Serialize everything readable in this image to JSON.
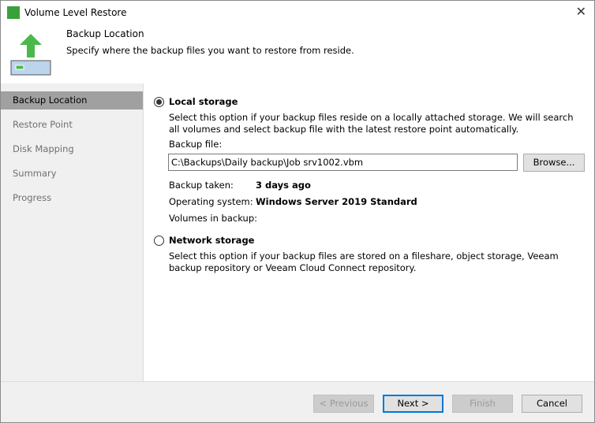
{
  "window": {
    "title": "Volume Level Restore",
    "close": "✕"
  },
  "header": {
    "title": "Backup Location",
    "description": "Specify where the backup files you want to restore from reside."
  },
  "sidebar": {
    "items": [
      {
        "label": "Backup Location"
      },
      {
        "label": "Restore Point"
      },
      {
        "label": "Disk Mapping"
      },
      {
        "label": "Summary"
      },
      {
        "label": "Progress"
      }
    ]
  },
  "main": {
    "local": {
      "label": "Local storage",
      "selected": true,
      "description": "Select this option if your backup files reside on a locally attached storage. We will search all volumes and select backup file with the latest restore point automatically.",
      "backup_file_label": "Backup file:",
      "backup_file_value": "C:\\Backups\\Daily backup\\Job srv1002.vbm",
      "browse": "Browse...",
      "backup_taken_label": "Backup taken:",
      "backup_taken_value": "3 days ago",
      "os_label": "Operating system:",
      "os_value": "Windows Server 2019 Standard",
      "volumes_label": "Volumes in backup:"
    },
    "network": {
      "label": "Network storage",
      "selected": false,
      "description": "Select this option if your backup files are stored on a fileshare, object storage, Veeam backup repository or Veeam Cloud Connect repository."
    }
  },
  "footer": {
    "previous": "< Previous",
    "next": "Next >",
    "finish": "Finish",
    "cancel": "Cancel"
  }
}
